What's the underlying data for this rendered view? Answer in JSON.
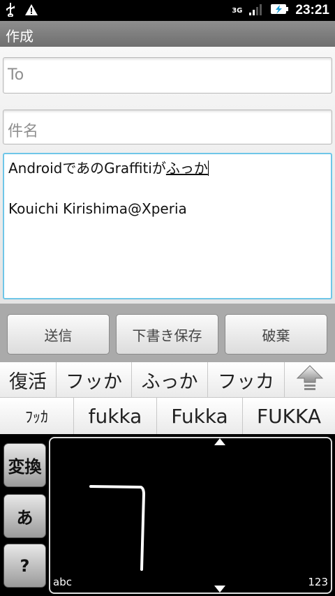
{
  "status_bar": {
    "network_type": "3G",
    "time": "23:21"
  },
  "title_bar": {
    "title": "作成"
  },
  "compose": {
    "to_placeholder": "To",
    "subject_placeholder": "件名",
    "body_committed": "Androidであの",
    "body_latin": "Graffitiが",
    "body_composing": "ふっか",
    "body_signature": "Kouichi Kirishima@Xperia"
  },
  "actions": {
    "send": "送信",
    "save_draft": "下書き保存",
    "discard": "破棄"
  },
  "candidates_row1": [
    "復活",
    "フッか",
    "ふっか",
    "フッカ"
  ],
  "candidates_row2": [
    "ﾌｯｶ",
    "fukka",
    "Fukka",
    "FUKKA"
  ],
  "ime": {
    "convert_label": "変換",
    "hiragana_label": "あ",
    "help_label": "?",
    "mode_left": "abc",
    "mode_right": "123"
  },
  "colors": {
    "focus_border": "#6fc6e8",
    "titlebar": "#7f7f7f"
  }
}
